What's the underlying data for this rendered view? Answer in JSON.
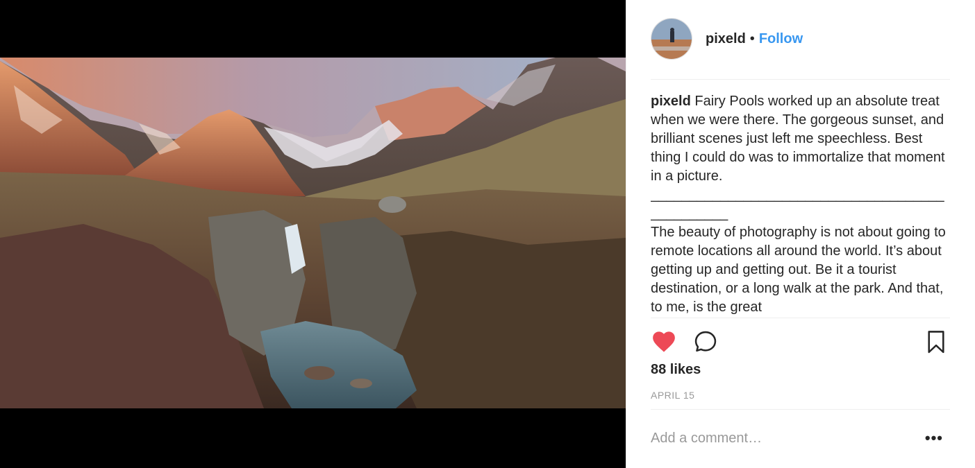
{
  "post": {
    "username": "pixeld",
    "separator": "•",
    "follow_label": "Follow",
    "caption": {
      "username": "pixeld",
      "text": "Fairy Pools worked up an absolute treat when we were there. The gorgeous sunset, and brilliant scenes just left me speechless. Best thing I could do was to immortalize that moment in a picture.",
      "divider": "________________________________________________",
      "body": "The beauty of photography is not about going to remote locations all around the world. It’s about getting up and getting out. Be it a tourist destination, or a long walk at the park. And that, to me, is the great"
    },
    "likes": "88 likes",
    "date": "APRIL 15",
    "comment_placeholder": "Add a comment…",
    "more_label": "•••"
  },
  "icons": {
    "like": "heart-icon",
    "comment": "comment-icon",
    "save": "bookmark-icon",
    "more": "more-options-icon"
  },
  "colors": {
    "follow": "#3897f0",
    "heart": "#ed4956",
    "text": "#262626",
    "muted": "#999999"
  }
}
